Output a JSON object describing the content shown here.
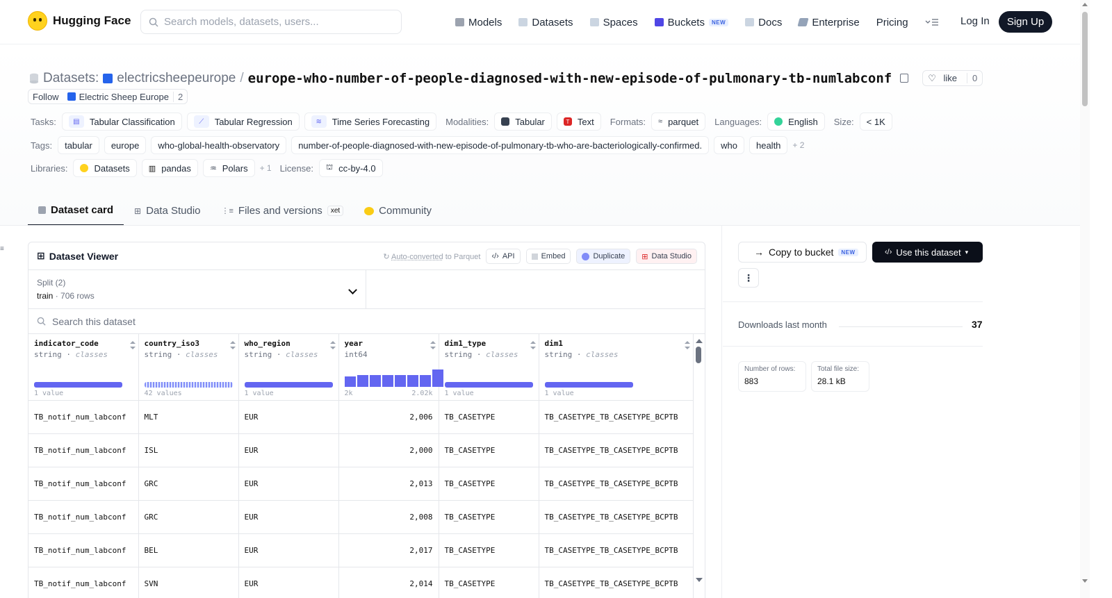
{
  "nav": {
    "brand": "Hugging Face",
    "search_placeholder": "Search models, datasets, users...",
    "links": [
      {
        "label": "Models",
        "icon": "models-icon",
        "color": "#9ca3af"
      },
      {
        "label": "Datasets",
        "icon": "datasets-icon",
        "color": "#cbd5e1"
      },
      {
        "label": "Spaces",
        "icon": "spaces-icon",
        "color": "#cbd5e1"
      },
      {
        "label": "Buckets",
        "icon": "buckets-icon",
        "color": "#4f46e5",
        "badge": "NEW"
      },
      {
        "label": "Docs",
        "icon": "docs-icon",
        "color": "#cbd5e1"
      },
      {
        "label": "Enterprise",
        "icon": "enterprise-icon",
        "color": "#94a3b8"
      },
      {
        "label": "Pricing",
        "icon": "",
        "color": ""
      }
    ],
    "login": "Log In",
    "signup": "Sign Up"
  },
  "repo": {
    "prefix": "Datasets:",
    "owner": "electricsheepeurope",
    "separator": "/",
    "name": "europe-who-number-of-people-diagnosed-with-new-episode-of-pulmonary-tb-numlabconf",
    "like_label": "like",
    "like_count": "0",
    "follow_label": "Follow",
    "org_name": "Electric Sheep Europe",
    "follow_count": "2"
  },
  "meta": {
    "tasks_label": "Tasks:",
    "tasks": [
      "Tabular Classification",
      "Tabular Regression",
      "Time Series Forecasting"
    ],
    "modalities_label": "Modalities:",
    "modalities": [
      "Tabular",
      "Text"
    ],
    "formats_label": "Formats:",
    "formats": [
      "parquet"
    ],
    "languages_label": "Languages:",
    "languages": [
      "English"
    ],
    "size_label": "Size:",
    "size": "< 1K",
    "tags_label": "Tags:",
    "tags": [
      "tabular",
      "europe",
      "who-global-health-observatory",
      "number-of-people-diagnosed-with-new-episode-of-pulmonary-tb-who-are-bacteriologically-confirmed.",
      "who",
      "health"
    ],
    "tags_more": "+ 2",
    "libraries_label": "Libraries:",
    "libraries": [
      "Datasets",
      "pandas",
      "Polars"
    ],
    "libraries_more": "+ 1",
    "license_label": "License:",
    "license": "cc-by-4.0"
  },
  "tabs": [
    {
      "label": "Dataset card",
      "active": true
    },
    {
      "label": "Data Studio",
      "active": false
    },
    {
      "label": "Files and versions",
      "active": false,
      "badge": "xet"
    },
    {
      "label": "Community",
      "active": false
    }
  ],
  "viewer": {
    "title": "Dataset Viewer",
    "autoconv_link": "Auto-converted",
    "autoconv_rest": "to Parquet",
    "buttons": [
      "API",
      "Embed",
      "Duplicate",
      "Data Studio"
    ],
    "split_label": "Split (2)",
    "split_value": "train",
    "split_rows": "706 rows",
    "search_placeholder": "Search this dataset",
    "columns": [
      {
        "name": "indicator_code",
        "type": "string",
        "kind": "classes",
        "foot_left": "1 value",
        "foot_right": "",
        "bar_fraction": 1.0,
        "chart": "bar"
      },
      {
        "name": "country_iso3",
        "type": "string",
        "kind": "classes",
        "foot_left": "42 values",
        "foot_right": "",
        "bar_fraction": 1.0,
        "chart": "striped"
      },
      {
        "name": "who_region",
        "type": "string",
        "kind": "classes",
        "foot_left": "1 value",
        "foot_right": "",
        "bar_fraction": 1.0,
        "chart": "bar"
      },
      {
        "name": "year",
        "type": "int64",
        "kind": "",
        "foot_left": "2k",
        "foot_right": "2.02k",
        "chart": "hist",
        "hist": [
          0.55,
          0.62,
          0.6,
          0.62,
          0.62,
          0.62,
          0.62,
          0.9
        ]
      },
      {
        "name": "dim1_type",
        "type": "string",
        "kind": "classes",
        "foot_left": "1 value",
        "foot_right": "",
        "bar_fraction": 1.0,
        "chart": "bar"
      },
      {
        "name": "dim1",
        "type": "string",
        "kind": "classes",
        "foot_left": "1 value",
        "foot_right": "",
        "bar_fraction": 1.0,
        "chart": "bar"
      }
    ],
    "rows": [
      [
        "TB_notif_num_labconf",
        "MLT",
        "EUR",
        "2,006",
        "TB_CASETYPE",
        "TB_CASETYPE_TB_CASETYPE_BCPTB"
      ],
      [
        "TB_notif_num_labconf",
        "ISL",
        "EUR",
        "2,000",
        "TB_CASETYPE",
        "TB_CASETYPE_TB_CASETYPE_BCPTB"
      ],
      [
        "TB_notif_num_labconf",
        "GRC",
        "EUR",
        "2,013",
        "TB_CASETYPE",
        "TB_CASETYPE_TB_CASETYPE_BCPTB"
      ],
      [
        "TB_notif_num_labconf",
        "GRC",
        "EUR",
        "2,008",
        "TB_CASETYPE",
        "TB_CASETYPE_TB_CASETYPE_BCPTB"
      ],
      [
        "TB_notif_num_labconf",
        "BEL",
        "EUR",
        "2,017",
        "TB_CASETYPE",
        "TB_CASETYPE_TB_CASETYPE_BCPTB"
      ],
      [
        "TB_notif_num_labconf",
        "SVN",
        "EUR",
        "2,014",
        "TB_CASETYPE",
        "TB_CASETYPE_TB_CASETYPE_BCPTB"
      ]
    ]
  },
  "sidebar": {
    "copy_bucket": "Copy to bucket",
    "copy_badge": "NEW",
    "use_dataset": "Use this dataset",
    "more": "⋮",
    "downloads_label": "Downloads last month",
    "downloads_value": "37",
    "rows_label": "Number of rows:",
    "rows_value": "883",
    "size_label": "Total file size:",
    "size_value": "28.1 kB"
  },
  "colors": {
    "accent": "#6366f1",
    "dark": "#111827"
  }
}
